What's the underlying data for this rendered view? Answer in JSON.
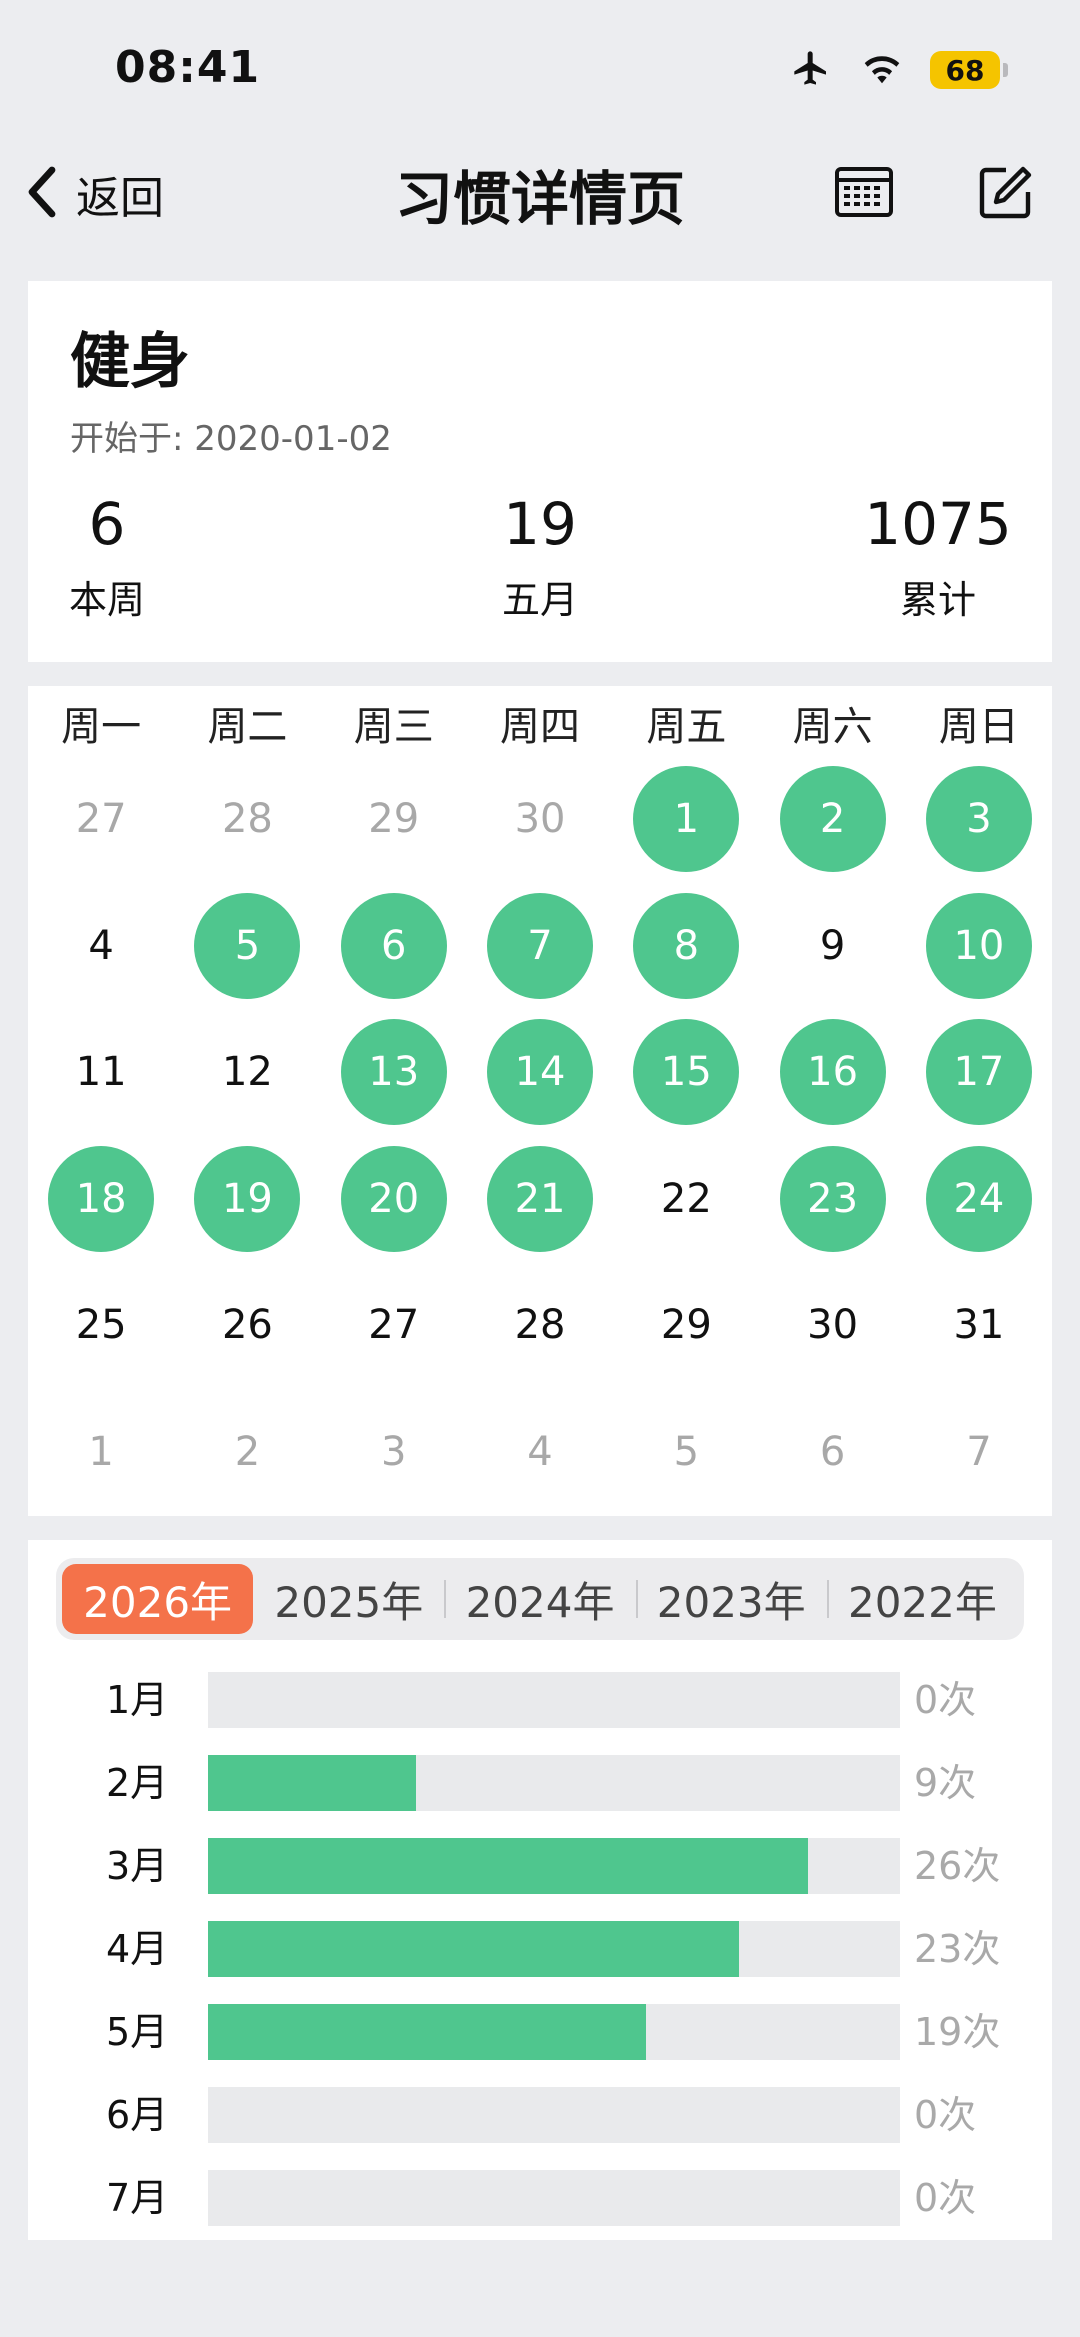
{
  "status_bar": {
    "time": "08:41",
    "battery": "68"
  },
  "nav": {
    "back_label": "返回",
    "title": "习惯详情页"
  },
  "habit": {
    "name": "健身",
    "start_date": "开始于: 2020-01-02",
    "stats": [
      {
        "value": "6",
        "label": "本周"
      },
      {
        "value": "19",
        "label": "五月"
      },
      {
        "value": "1075",
        "label": "累计"
      }
    ]
  },
  "calendar": {
    "weekdays": [
      "周一",
      "周二",
      "周三",
      "周四",
      "周五",
      "周六",
      "周日"
    ],
    "days": [
      {
        "n": "27",
        "state": "muted"
      },
      {
        "n": "28",
        "state": "muted"
      },
      {
        "n": "29",
        "state": "muted"
      },
      {
        "n": "30",
        "state": "muted"
      },
      {
        "n": "1",
        "state": "done"
      },
      {
        "n": "2",
        "state": "done"
      },
      {
        "n": "3",
        "state": "done"
      },
      {
        "n": "4",
        "state": "normal"
      },
      {
        "n": "5",
        "state": "done"
      },
      {
        "n": "6",
        "state": "done"
      },
      {
        "n": "7",
        "state": "done"
      },
      {
        "n": "8",
        "state": "done"
      },
      {
        "n": "9",
        "state": "normal"
      },
      {
        "n": "10",
        "state": "done"
      },
      {
        "n": "11",
        "state": "normal"
      },
      {
        "n": "12",
        "state": "normal"
      },
      {
        "n": "13",
        "state": "done"
      },
      {
        "n": "14",
        "state": "done"
      },
      {
        "n": "15",
        "state": "done"
      },
      {
        "n": "16",
        "state": "done"
      },
      {
        "n": "17",
        "state": "done"
      },
      {
        "n": "18",
        "state": "done"
      },
      {
        "n": "19",
        "state": "done"
      },
      {
        "n": "20",
        "state": "done"
      },
      {
        "n": "21",
        "state": "done"
      },
      {
        "n": "22",
        "state": "normal"
      },
      {
        "n": "23",
        "state": "done"
      },
      {
        "n": "24",
        "state": "done"
      },
      {
        "n": "25",
        "state": "normal"
      },
      {
        "n": "26",
        "state": "normal"
      },
      {
        "n": "27",
        "state": "normal"
      },
      {
        "n": "28",
        "state": "normal"
      },
      {
        "n": "29",
        "state": "normal"
      },
      {
        "n": "30",
        "state": "normal"
      },
      {
        "n": "31",
        "state": "normal"
      },
      {
        "n": "1",
        "state": "muted"
      },
      {
        "n": "2",
        "state": "muted"
      },
      {
        "n": "3",
        "state": "muted"
      },
      {
        "n": "4",
        "state": "muted"
      },
      {
        "n": "5",
        "state": "muted"
      },
      {
        "n": "6",
        "state": "muted"
      },
      {
        "n": "7",
        "state": "muted"
      }
    ]
  },
  "year_tabs": [
    "2026年",
    "2025年",
    "2024年",
    "2023年",
    "2022年"
  ],
  "selected_year_index": 0,
  "colors": {
    "accent_green": "#4FC68E",
    "accent_orange": "#F4724A",
    "battery_yellow": "#F5C400"
  },
  "chart_data": {
    "type": "bar",
    "categories": [
      "1月",
      "2月",
      "3月",
      "4月",
      "5月",
      "6月",
      "7月"
    ],
    "values": [
      0,
      9,
      26,
      23,
      19,
      0,
      0
    ],
    "value_labels": [
      "0次",
      "9次",
      "26次",
      "23次",
      "19次",
      "0次",
      "0次"
    ],
    "xlim": [
      0,
      30
    ]
  }
}
